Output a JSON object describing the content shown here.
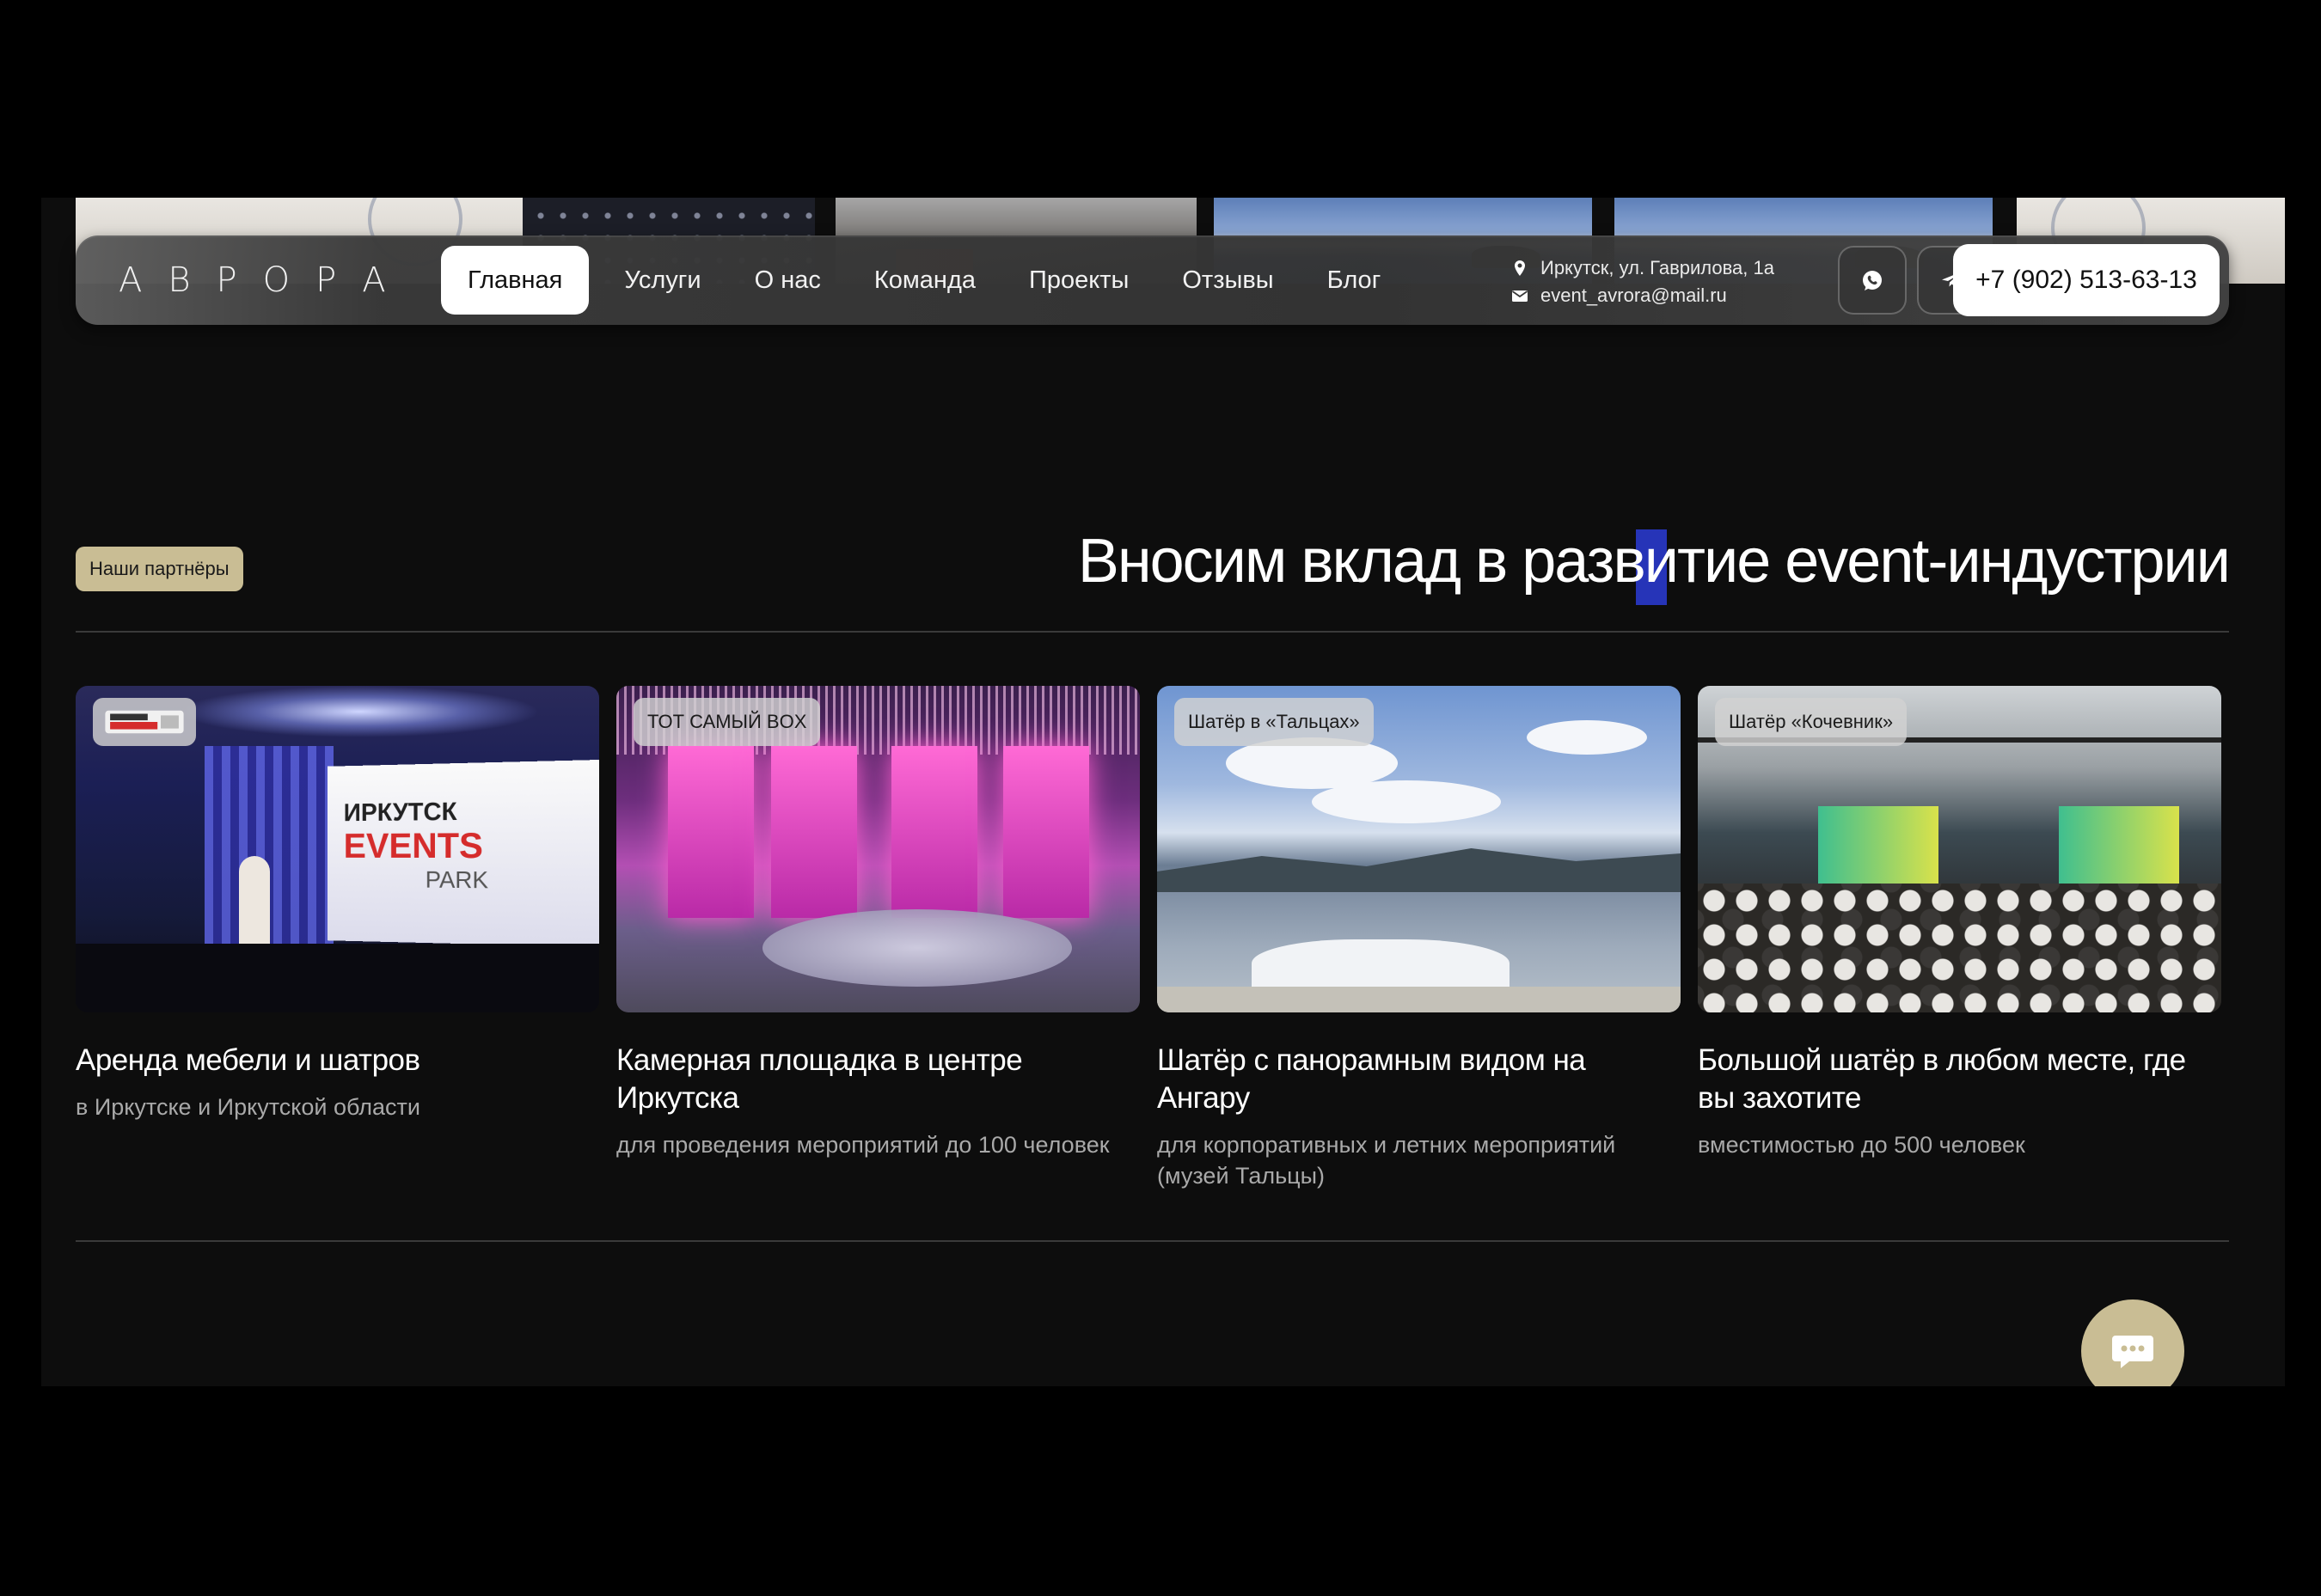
{
  "header": {
    "logo": "АВРОРА",
    "nav": [
      {
        "label": "Главная",
        "active": true
      },
      {
        "label": "Услуги",
        "active": false
      },
      {
        "label": "О нас",
        "active": false
      },
      {
        "label": "Команда",
        "active": false
      },
      {
        "label": "Проекты",
        "active": false
      },
      {
        "label": "Отзывы",
        "active": false
      },
      {
        "label": "Блог",
        "active": false
      }
    ],
    "address": "Иркутск, ул. Гаврилова, 1а",
    "email": "event_avrora@mail.ru",
    "icons": {
      "address": "location-pin-icon",
      "email": "envelope-icon",
      "whatsapp": "whatsapp-icon",
      "telegram": "telegram-icon"
    },
    "phone": "+7 (902) 513-63-13"
  },
  "partners": {
    "badge": "Наши партнёры",
    "title": "Вносим вклад в развитие event-индустрии",
    "cards": [
      {
        "tag": "",
        "title": "Аренда мебели и шатров",
        "subtitle": "в Иркутске и Иркутской области",
        "image_text": [
          "ИРКУТСК",
          "EVENTS",
          "PARK"
        ]
      },
      {
        "tag": "ТОТ САМЫЙ BOX",
        "title": "Камерная площадка в центре Иркутска",
        "subtitle": "для проведения мероприятий до 100 человек"
      },
      {
        "tag": "Шатёр в «Тальцах»",
        "title": "Шатёр с панорамным видом на Ангару",
        "subtitle": "для корпоративных и летних мероприятий (музей Тальцы)"
      },
      {
        "tag": "Шатёр «Кочевник»",
        "title": "Большой шатёр в любом месте, где вы захотите",
        "subtitle": "вместимостью до 500 человек"
      }
    ]
  },
  "chat": {
    "icon": "chat-bubble-icon"
  },
  "colors": {
    "accent": "#c9bd94",
    "background": "#0d0d0d",
    "caret": "#2634b8"
  }
}
